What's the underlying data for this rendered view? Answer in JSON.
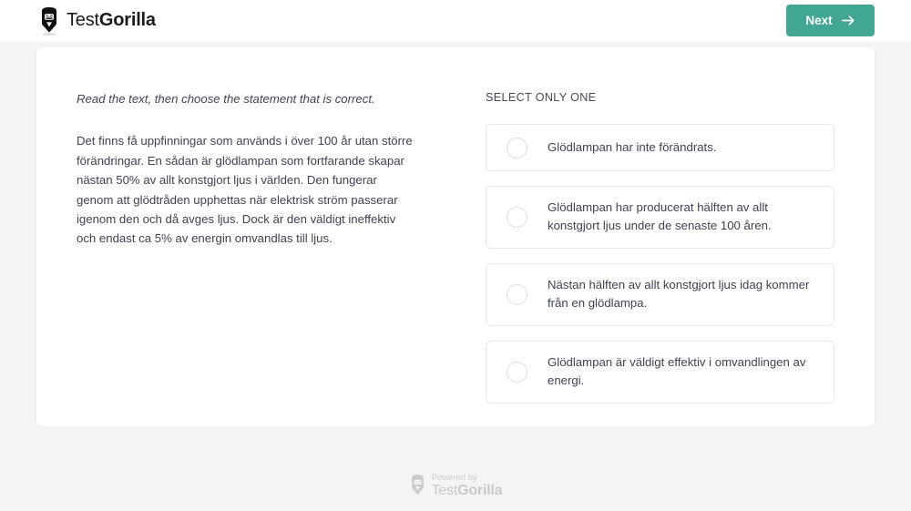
{
  "header": {
    "brand": {
      "icon": "gorilla-head-icon",
      "name_light": "Test",
      "name_bold": "Gorilla"
    },
    "next_button": {
      "label": "Next",
      "icon": "arrow-right-icon"
    }
  },
  "main": {
    "instruction": "Read the text, then choose the statement that is correct.",
    "passage": "Det finns få uppfinningar som används i över 100 år utan större förändringar. En sådan är glödlampan som fortfarande skapar nästan 50% av allt konstgjort ljus i världen. Den fungerar genom att glödtråden upphettas när elektrisk ström passerar igenom den och då avges ljus. Dock är den väldigt ineffektiv och endast ca 5% av energin omvandlas till ljus.",
    "select_label": "SELECT ONLY ONE",
    "options": [
      {
        "text": "Glödlampan har inte förändrats."
      },
      {
        "text": "Glödlampan har producerat hälften av allt konstgjort ljus under de senaste 100 åren."
      },
      {
        "text": "Nästan hälften av allt konstgjort ljus idag kommer från en glödlampa."
      },
      {
        "text": "Glödlampan är väldigt effektiv i omvandlingen av energi."
      }
    ]
  },
  "footer": {
    "powered_by": "Powered by",
    "brand_light": "Test",
    "brand_bold": "Gorilla",
    "icon": "gorilla-head-icon"
  },
  "colors": {
    "accent": "#41a694",
    "page_background": "#f4f4f5",
    "card_background": "#ffffff",
    "text": "#3f4254",
    "border": "#e8e8ea"
  }
}
